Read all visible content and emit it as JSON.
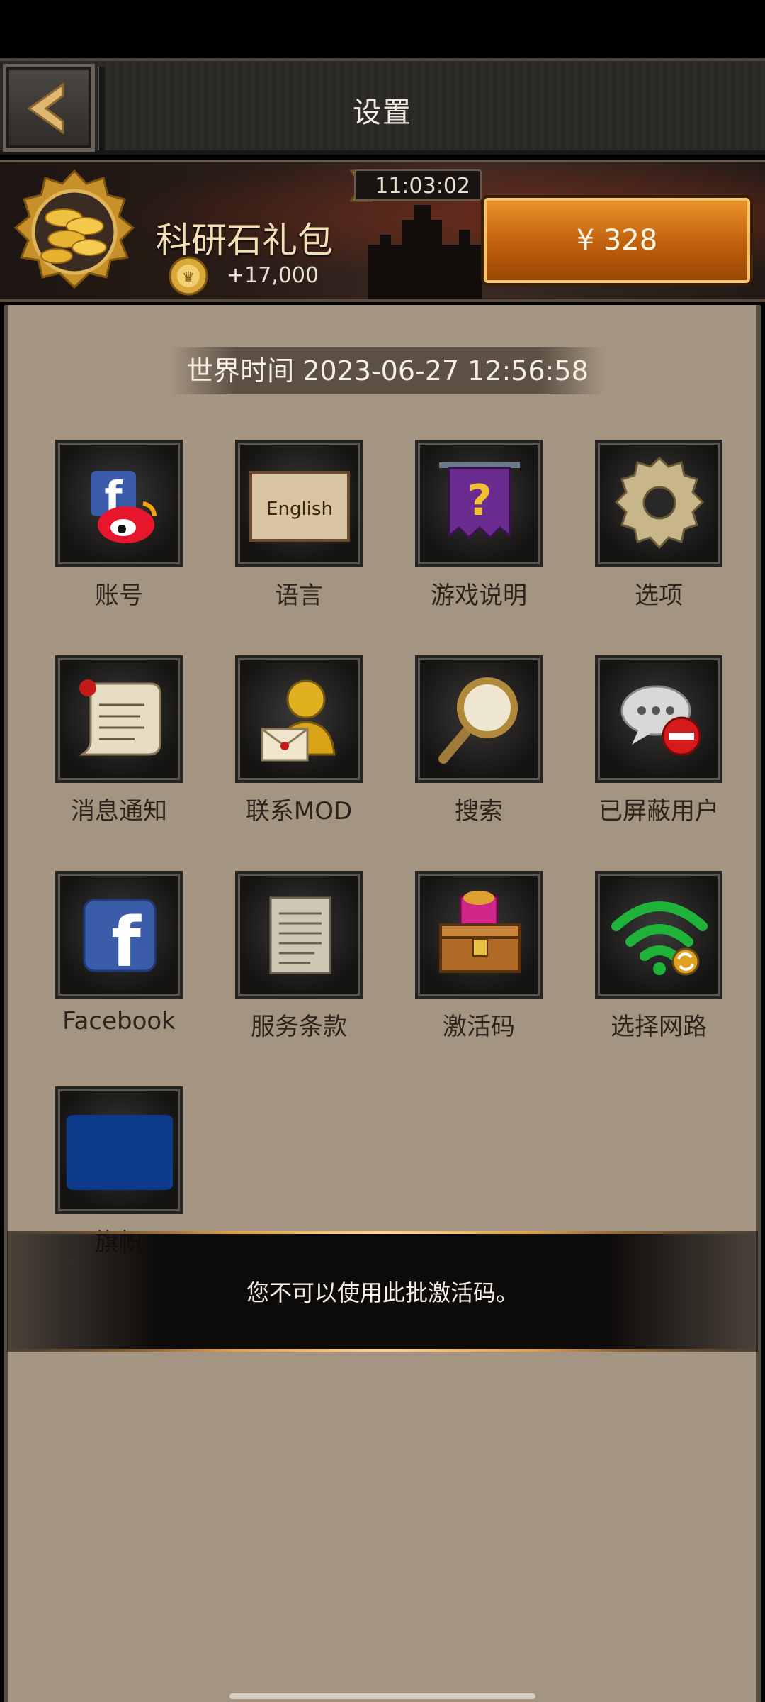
{
  "header": {
    "title": "设置"
  },
  "banner": {
    "timer": "11:03:02",
    "title": "科研石礼包",
    "amount": "+17,000",
    "price": "¥ 328"
  },
  "world_time": "世界时间 2023-06-27  12:56:58",
  "settings_grid": [
    {
      "label": "账号",
      "icon": "facebook-weibo-icon"
    },
    {
      "label": "语言",
      "icon": "language-scroll-icon",
      "icon_text": "English"
    },
    {
      "label": "游戏说明",
      "icon": "help-banner-icon"
    },
    {
      "label": "选项",
      "icon": "gear-icon"
    },
    {
      "label": "消息通知",
      "icon": "scroll-icon"
    },
    {
      "label": "联系MOD",
      "icon": "moderator-mail-icon"
    },
    {
      "label": "搜索",
      "icon": "magnifier-icon"
    },
    {
      "label": "已屏蔽用户",
      "icon": "blocked-chat-icon"
    },
    {
      "label": "Facebook",
      "icon": "facebook-icon"
    },
    {
      "label": "服务条款",
      "icon": "document-icon"
    },
    {
      "label": "激活码",
      "icon": "treasure-chest-icon"
    },
    {
      "label": "选择网路",
      "icon": "wifi-icon"
    },
    {
      "label": "旗帜",
      "icon": "flag-icon"
    }
  ],
  "toast": {
    "message": "您不可以使用此批激活码。"
  },
  "colors": {
    "panel": "#a49482",
    "price_button": "#d9781a",
    "flag_blue": "#0e3a8c",
    "wifi_green": "#1fb33a"
  }
}
